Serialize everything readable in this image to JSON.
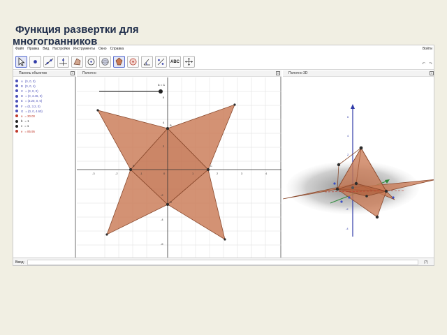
{
  "slide": {
    "title_line1": "Функция развертки для",
    "title_line2": "многогранников"
  },
  "app": {
    "menu": [
      "Файл",
      "Правка",
      "Вид",
      "Настройки",
      "Инструменты",
      "Окно",
      "Справка"
    ],
    "login": "Войти",
    "toolbar": {
      "abc_label": "ABC",
      "undo_icon": "undo-icon",
      "redo_icon": "redo-icon"
    },
    "algebra_view": {
      "title": "Панель объектов",
      "items": [
        {
          "name": "A",
          "value": "(0, 0, 0)",
          "color": "#4a4fb8"
        },
        {
          "name": "B",
          "value": "(0, 0, 4)",
          "color": "#4a4fb8"
        },
        {
          "name": "C",
          "value": "= (3, 0, 0)",
          "color": "#4a4fb8"
        },
        {
          "name": "D",
          "value": "= (0, 3.46, 0)",
          "color": "#4a4fb8"
        },
        {
          "name": "E",
          "value": "= (3.20, 0, 0)",
          "color": "#4a4fb8"
        },
        {
          "name": "F",
          "value": "= (0, 3.2, 0)",
          "color": "#4a4fb8"
        },
        {
          "name": "G",
          "value": "= (0, 0, 4.60)",
          "color": "#4a4fb8"
        },
        {
          "name": "a",
          "value": "= 30.00",
          "color": "#c0392b"
        },
        {
          "name": "b",
          "value": "= 1",
          "color": "#222222"
        },
        {
          "name": "c",
          "value": "= 1",
          "color": "#222222"
        },
        {
          "name": "e",
          "value": "= 85.95",
          "color": "#c0392b"
        }
      ]
    },
    "graphics_view": {
      "title": "Полотно",
      "slider_label": "a = 1",
      "x_ticks": [
        "-3",
        "-2",
        "-1",
        "0",
        "1",
        "2",
        "3",
        "4",
        "5"
      ],
      "y_ticks": [
        "6",
        "4",
        "2",
        "-2",
        "-4",
        "-6"
      ],
      "point_labels": [
        "B",
        "C",
        "D",
        "E"
      ]
    },
    "graphics3d_view": {
      "title": "Полотно 3D",
      "z_ticks": [
        "6",
        "4",
        "2",
        "-2",
        "-4"
      ]
    },
    "input_bar": {
      "label": "Ввод:",
      "help": "(?)"
    }
  },
  "colors": {
    "net_fill": "#c97a55",
    "net_stroke": "#8a4a2e",
    "axis": "#333333",
    "point": "#2c2c2c",
    "ground": "#8c8c8c"
  }
}
